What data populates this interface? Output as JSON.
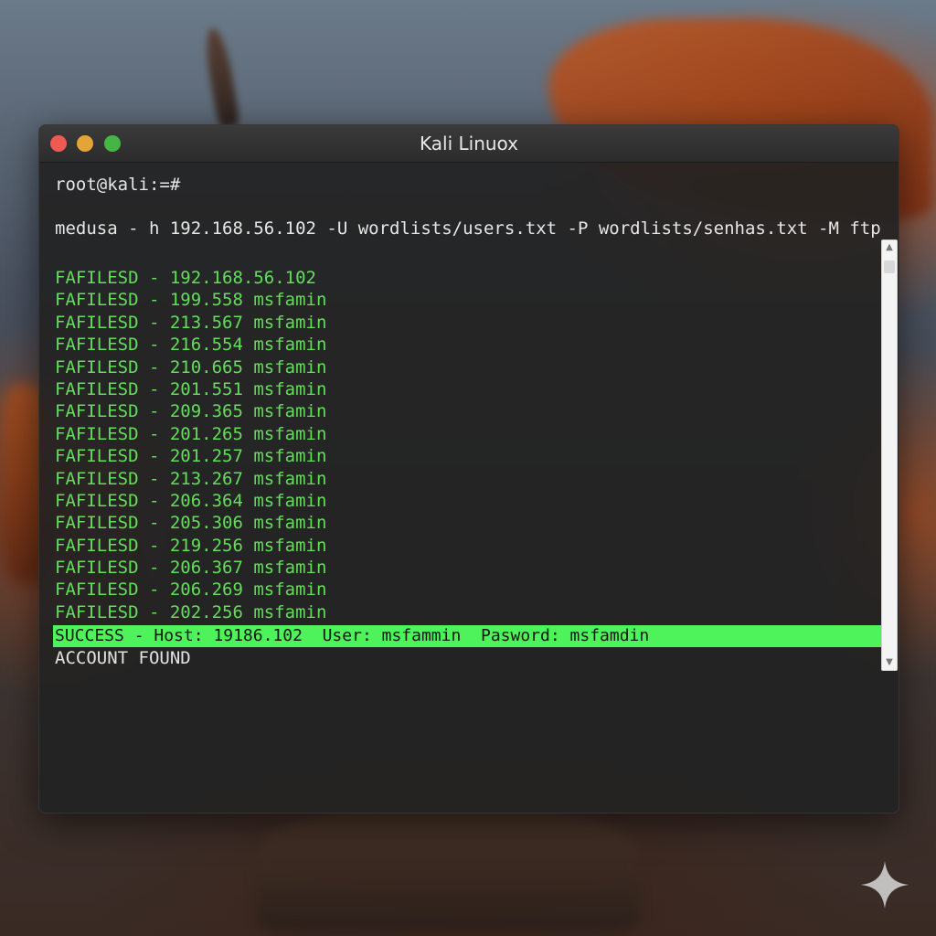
{
  "window": {
    "title": "Kali Linuox"
  },
  "terminal": {
    "prompt": "root@kali:=#",
    "command": "medusa - h 192.168.56.102 -U wordlists/users.txt -P wordlists/senhas.txt -M ftp",
    "log_lines": [
      "FAFILESD - 192.168.56.102",
      "FAFILESD - 199.558 msfamin",
      "FAFILESD - 213.567 msfamin",
      "FAFILESD - 216.554 msfamin",
      "FAFILESD - 210.665 msfamin",
      "FAFILESD - 201.551 msfamin",
      "FAFILESD - 209.365 msfamin",
      "FAFILESD - 201.265 msfamin",
      "FAFILESD - 201.257 msfamin",
      "FAFILESD - 213.267 msfamin",
      "FAFILESD - 206.364 msfamin",
      "FAFILESD - 205.306 msfamin",
      "FAFILESD - 219.256 msfamin",
      "FAFILESD - 206.367 msfamin",
      "FAFILESD - 206.269 msfamin",
      "FAFILESD - 202.256 msfamin"
    ],
    "success_line": "SUCCESS - Host: 19186.102  User: msfammin  Pasword: msfamdin",
    "found_line": "ACCOUNT FOUND"
  },
  "icons": {
    "close": "close-icon",
    "minimize": "minimize-icon",
    "maximize": "maximize-icon",
    "sparkle": "sparkle-icon"
  },
  "colors": {
    "close": "#ee5a52",
    "minimize": "#e6a33b",
    "maximize": "#45b644",
    "log_text": "#63dd5a",
    "success_bg": "#4ef25a"
  }
}
